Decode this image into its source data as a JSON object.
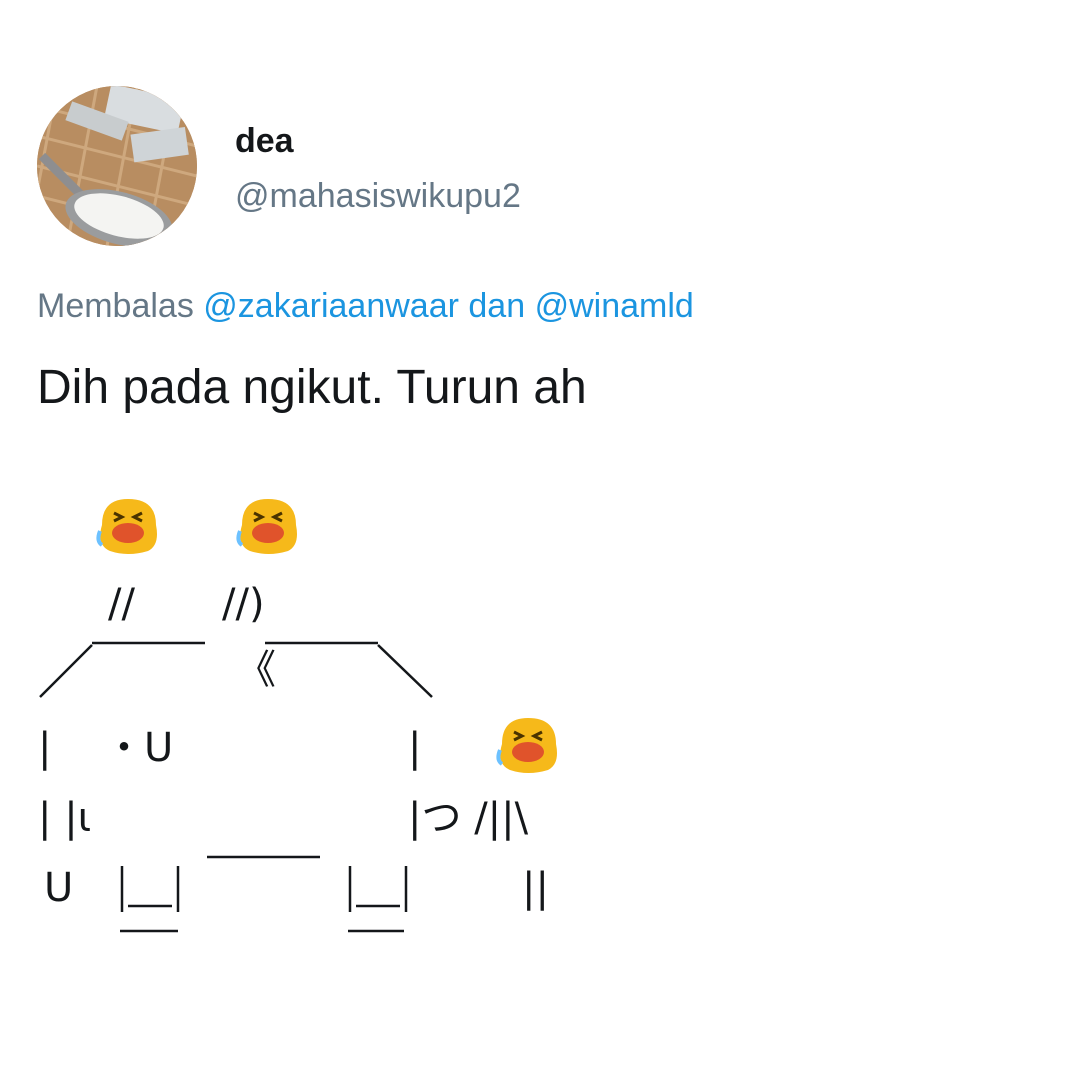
{
  "tweet": {
    "display_name": "dea",
    "handle": "@mahasiswikupu2",
    "reply": {
      "prefix": "Membalas",
      "mention_1": "@zakariaanwaar",
      "joiner": "dan",
      "mention_2": "@winamld"
    },
    "text": "Dih pada ngikut. Turun ah",
    "emoji": "crying-face-emoji",
    "art": {
      "line_1": "//",
      "line_2": "//)",
      "line_3": "《",
      "line_4a": "|",
      "line_4b": "・U",
      "line_4c": "|",
      "line_5a": "| |ι",
      "line_5b": "|つ /||\\",
      "line_6a": "U",
      "line_6b": "||"
    }
  },
  "colors": {
    "text": "#14171a",
    "muted": "#657786",
    "link": "#1b95e0",
    "emoji_yellow": "#f6b91a",
    "emoji_mouth": "#e0532b"
  }
}
